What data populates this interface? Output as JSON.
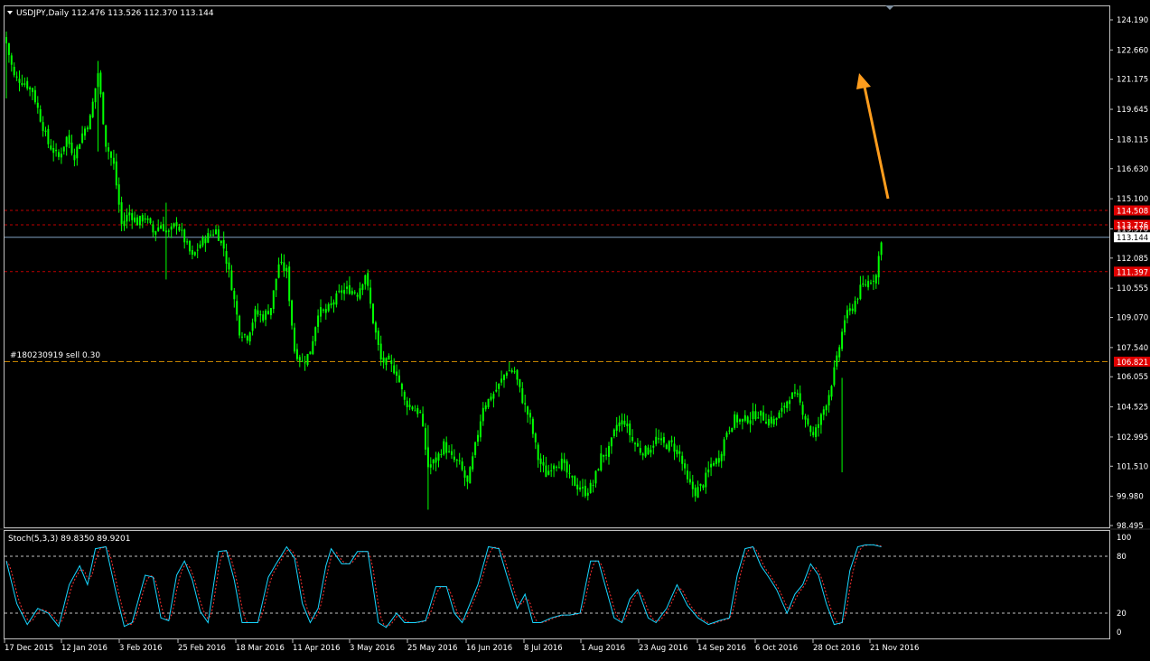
{
  "chart_data": {
    "type": "candlestick",
    "main": {
      "header": "USDJPY,Daily  112.476 113.526 112.370 113.144",
      "ylim": [
        98.495,
        124.19
      ],
      "y_ticks": [
        "124.190",
        "122.660",
        "121.175",
        "119.645",
        "118.115",
        "116.630",
        "115.100",
        "113.570",
        "112.085",
        "110.555",
        "109.070",
        "107.540",
        "106.055",
        "104.525",
        "102.995",
        "101.510",
        "99.980",
        "98.495"
      ],
      "price_lines": [
        {
          "label": "114.508",
          "value": 114.508,
          "kind": "red"
        },
        {
          "label": "113.776",
          "value": 113.776,
          "kind": "red"
        },
        {
          "label": "113.144",
          "value": 113.144,
          "kind": "current"
        },
        {
          "label": "111.397",
          "value": 111.397,
          "kind": "red"
        },
        {
          "label": "106.821",
          "value": 106.821,
          "kind": "order"
        }
      ],
      "order_label": "#180230919 sell 0.30",
      "x_labels": [
        "17 Dec 2015",
        "12 Jan 2016",
        "3 Feb 2016",
        "25 Feb 2016",
        "18 Mar 2016",
        "11 Apr 2016",
        "3 May 2016",
        "25 May 2016",
        "16 Jun 2016",
        "8 Jul 2016",
        "1 Aug 2016",
        "23 Aug 2016",
        "14 Sep 2016",
        "6 Oct 2016",
        "28 Oct 2016",
        "21 Nov 2016"
      ],
      "close_path": [
        [
          0,
          123.0
        ],
        [
          3,
          121.3
        ],
        [
          7,
          121.0
        ],
        [
          10,
          120.6
        ],
        [
          13,
          119.2
        ],
        [
          16,
          117.9
        ],
        [
          20,
          117.2
        ],
        [
          23,
          118.2
        ],
        [
          26,
          117.3
        ],
        [
          29,
          118.4
        ],
        [
          32,
          119.2
        ],
        [
          35,
          121.5
        ],
        [
          38,
          117.9
        ],
        [
          41,
          116.8
        ],
        [
          44,
          113.8
        ],
        [
          47,
          114.4
        ],
        [
          50,
          113.9
        ],
        [
          53,
          114.2
        ],
        [
          56,
          113.4
        ],
        [
          59,
          113.8
        ],
        [
          62,
          113.3
        ],
        [
          65,
          113.9
        ],
        [
          68,
          113.0
        ],
        [
          71,
          112.1
        ],
        [
          74,
          112.8
        ],
        [
          77,
          113.2
        ],
        [
          80,
          113.5
        ],
        [
          83,
          112.6
        ],
        [
          86,
          110.7
        ],
        [
          89,
          108.4
        ],
        [
          92,
          108.1
        ],
        [
          95,
          109.3
        ],
        [
          98,
          109.1
        ],
        [
          101,
          109.6
        ],
        [
          104,
          111.8
        ],
        [
          107,
          111.4
        ],
        [
          110,
          107.4
        ],
        [
          113,
          106.8
        ],
        [
          116,
          107.3
        ],
        [
          119,
          109.4
        ],
        [
          122,
          109.3
        ],
        [
          125,
          109.9
        ],
        [
          128,
          110.4
        ],
        [
          131,
          110.5
        ],
        [
          134,
          110.3
        ],
        [
          137,
          111.3
        ],
        [
          140,
          108.9
        ],
        [
          143,
          106.9
        ],
        [
          146,
          106.7
        ],
        [
          149,
          106.3
        ],
        [
          152,
          104.8
        ],
        [
          155,
          104.5
        ],
        [
          158,
          104.2
        ],
        [
          161,
          101.5
        ],
        [
          164,
          101.8
        ],
        [
          167,
          102.6
        ],
        [
          170,
          101.9
        ],
        [
          173,
          101.6
        ],
        [
          176,
          100.6
        ],
        [
          179,
          102.5
        ],
        [
          182,
          104.6
        ],
        [
          185,
          105.0
        ],
        [
          188,
          105.6
        ],
        [
          191,
          106.4
        ],
        [
          194,
          106.3
        ],
        [
          197,
          104.9
        ],
        [
          200,
          103.8
        ],
        [
          203,
          101.9
        ],
        [
          206,
          101.1
        ],
        [
          209,
          101.7
        ],
        [
          212,
          101.7
        ],
        [
          215,
          100.9
        ],
        [
          218,
          100.5
        ],
        [
          221,
          100.2
        ],
        [
          224,
          100.6
        ],
        [
          227,
          102.0
        ],
        [
          230,
          102.3
        ],
        [
          233,
          103.6
        ],
        [
          236,
          103.8
        ],
        [
          239,
          102.8
        ],
        [
          242,
          102.3
        ],
        [
          245,
          102.3
        ],
        [
          248,
          102.9
        ],
        [
          251,
          102.6
        ],
        [
          254,
          102.6
        ],
        [
          257,
          102.1
        ],
        [
          260,
          100.7
        ],
        [
          263,
          100.2
        ],
        [
          266,
          100.6
        ],
        [
          269,
          101.6
        ],
        [
          272,
          101.9
        ],
        [
          275,
          103.3
        ],
        [
          278,
          103.9
        ],
        [
          281,
          103.8
        ],
        [
          284,
          104.0
        ],
        [
          287,
          104.2
        ],
        [
          290,
          103.9
        ],
        [
          293,
          103.8
        ],
        [
          296,
          104.3
        ],
        [
          299,
          105.1
        ],
        [
          302,
          105.0
        ],
        [
          305,
          104.0
        ],
        [
          308,
          103.0
        ],
        [
          311,
          104.0
        ],
        [
          314,
          105.2
        ],
        [
          317,
          106.9
        ],
        [
          320,
          109.0
        ],
        [
          323,
          109.6
        ],
        [
          326,
          110.5
        ],
        [
          329,
          110.9
        ],
        [
          332,
          111.2
        ],
        [
          334,
          113.1
        ]
      ]
    },
    "stoch": {
      "header": "Stoch(5,3,3) 89.8350 89.9201",
      "ylim": [
        0,
        100
      ],
      "y_ticks": [
        "100",
        "80",
        "20",
        "0"
      ],
      "levels": [
        80,
        20
      ],
      "cycle": [
        [
          0,
          75
        ],
        [
          4,
          30
        ],
        [
          8,
          8
        ],
        [
          12,
          25
        ],
        [
          16,
          20
        ],
        [
          20,
          6
        ],
        [
          24,
          50
        ],
        [
          28,
          70
        ],
        [
          31,
          50
        ],
        [
          34,
          88
        ],
        [
          38,
          90
        ],
        [
          42,
          40
        ],
        [
          45,
          6
        ],
        [
          48,
          10
        ],
        [
          53,
          60
        ],
        [
          56,
          58
        ],
        [
          59,
          15
        ],
        [
          62,
          12
        ],
        [
          65,
          60
        ],
        [
          68,
          75
        ],
        [
          71,
          55
        ],
        [
          74,
          22
        ],
        [
          77,
          10
        ],
        [
          81,
          85
        ],
        [
          84,
          86
        ],
        [
          87,
          55
        ],
        [
          90,
          10
        ],
        [
          93,
          10
        ],
        [
          96,
          10
        ],
        [
          100,
          58
        ],
        [
          103,
          72
        ],
        [
          107,
          90
        ],
        [
          110,
          78
        ],
        [
          113,
          30
        ],
        [
          116,
          10
        ],
        [
          119,
          25
        ],
        [
          122,
          70
        ],
        [
          124,
          88
        ],
        [
          128,
          72
        ],
        [
          131,
          72
        ],
        [
          134,
          85
        ],
        [
          138,
          85
        ],
        [
          142,
          10
        ],
        [
          145,
          5
        ],
        [
          149,
          20
        ],
        [
          152,
          10
        ],
        [
          156,
          10
        ],
        [
          160,
          12
        ],
        [
          164,
          48
        ],
        [
          168,
          48
        ],
        [
          171,
          20
        ],
        [
          174,
          10
        ],
        [
          177,
          30
        ],
        [
          180,
          50
        ],
        [
          184,
          90
        ],
        [
          188,
          88
        ],
        [
          191,
          60
        ],
        [
          195,
          25
        ],
        [
          198,
          40
        ],
        [
          201,
          10
        ],
        [
          204,
          10
        ],
        [
          208,
          15
        ],
        [
          212,
          18
        ],
        [
          215,
          18
        ],
        [
          219,
          20
        ],
        [
          223,
          75
        ],
        [
          226,
          75
        ],
        [
          229,
          45
        ],
        [
          232,
          15
        ],
        [
          235,
          10
        ],
        [
          238,
          35
        ],
        [
          241,
          45
        ],
        [
          245,
          15
        ],
        [
          248,
          10
        ],
        [
          252,
          25
        ],
        [
          256,
          50
        ],
        [
          260,
          28
        ],
        [
          264,
          15
        ],
        [
          268,
          8
        ],
        [
          272,
          12
        ],
        [
          276,
          15
        ],
        [
          279,
          60
        ],
        [
          282,
          88
        ],
        [
          285,
          90
        ],
        [
          288,
          70
        ],
        [
          291,
          58
        ],
        [
          294,
          45
        ],
        [
          298,
          20
        ],
        [
          301,
          40
        ],
        [
          304,
          50
        ],
        [
          307,
          72
        ],
        [
          310,
          60
        ],
        [
          313,
          30
        ],
        [
          316,
          8
        ],
        [
          319,
          10
        ],
        [
          322,
          65
        ],
        [
          325,
          90
        ],
        [
          328,
          92
        ],
        [
          331,
          92
        ],
        [
          334,
          90
        ]
      ]
    }
  },
  "colors": {
    "background": "#000000",
    "candle": "#00ff00",
    "grid_text": "#ffffff",
    "axis": "#c0c0c0",
    "red_line": "#c00000",
    "current_line": "#7f9fbf",
    "order_line": "#c08000",
    "stoch_main": "#17d6ff",
    "stoch_signal": "#ff3030",
    "arrow": "#ff9d1d"
  }
}
